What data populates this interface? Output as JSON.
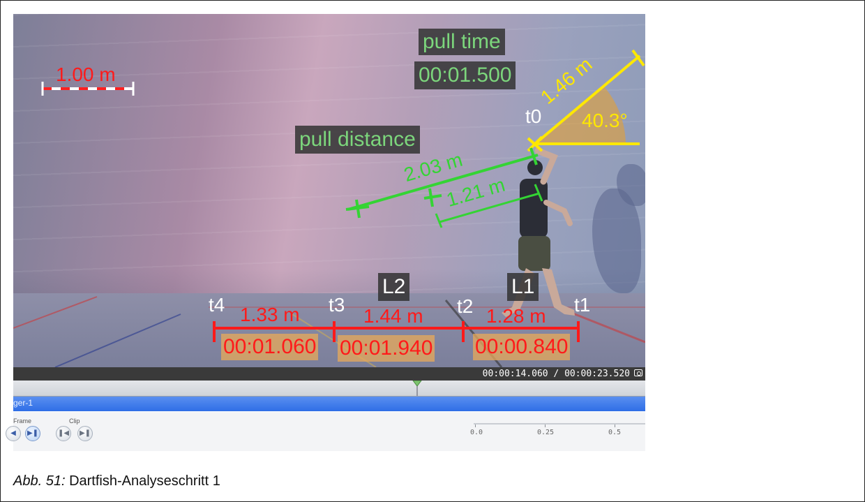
{
  "overlay": {
    "scale_label": "1.00 m",
    "pull_time_title": "pull time",
    "pull_time_value": "00:01.500",
    "pull_distance_title": "pull distance",
    "dist_long": "2.03 m",
    "dist_short": "1.21 m",
    "angle_length": "1.46 m",
    "angle_value": "40.3°",
    "t0": "t0",
    "t1": "t1",
    "t2": "t2",
    "t3": "t3",
    "t4": "t4",
    "L1": "L1",
    "L2": "L2",
    "seg_t4_t3_distance": "1.33 m",
    "seg_t3_t2_distance": "1.44 m",
    "seg_t2_t1_distance": "1.28 m",
    "seg_t4_t3_time": "00:01.060",
    "seg_t3_t2_time": "00:01.940",
    "seg_t2_t1_time": "00:00.840"
  },
  "player": {
    "timecode": "00:00:14.060 / 00:00:23.520",
    "track_name": "ger-1",
    "frame_label": "Frame",
    "clip_label": "Clip",
    "speed_ticks": [
      "0.0",
      "0.25",
      "0.5"
    ]
  },
  "caption": {
    "prefix": "Abb. 51:",
    "text": " Dartfish-Analyseschritt 1"
  },
  "colors": {
    "measure_red": "#ff1a1a",
    "pull_green": "#34d434",
    "angle_yellow": "#ffe800",
    "track_blue": "#2f6ee6"
  }
}
